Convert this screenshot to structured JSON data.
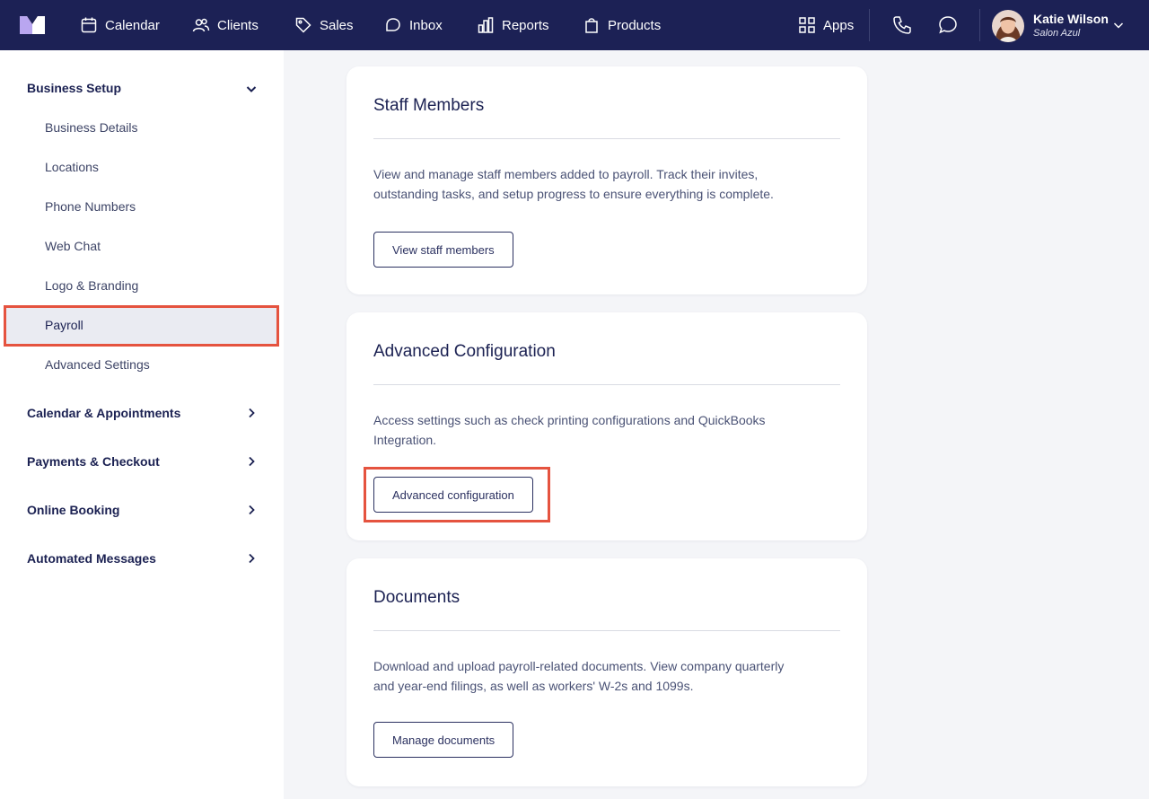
{
  "nav": {
    "items": [
      {
        "label": "Calendar",
        "icon": "calendar-icon"
      },
      {
        "label": "Clients",
        "icon": "clients-icon"
      },
      {
        "label": "Sales",
        "icon": "tag-icon"
      },
      {
        "label": "Inbox",
        "icon": "inbox-icon"
      },
      {
        "label": "Reports",
        "icon": "bar-chart-icon"
      },
      {
        "label": "Products",
        "icon": "bag-icon"
      }
    ],
    "apps_label": "Apps",
    "user": {
      "name": "Katie Wilson",
      "business": "Salon Azul"
    }
  },
  "sidebar": {
    "sections": [
      {
        "label": "Business Setup",
        "expanded": true
      },
      {
        "label": "Calendar & Appointments"
      },
      {
        "label": "Payments & Checkout"
      },
      {
        "label": "Online Booking"
      },
      {
        "label": "Automated Messages"
      }
    ],
    "business_setup_items": [
      {
        "label": "Business Details"
      },
      {
        "label": "Locations"
      },
      {
        "label": "Phone Numbers"
      },
      {
        "label": "Web Chat"
      },
      {
        "label": "Logo & Branding"
      },
      {
        "label": "Payroll",
        "active": true
      },
      {
        "label": "Advanced Settings"
      }
    ]
  },
  "cards": [
    {
      "title": "Staff Members",
      "description": "View and manage staff members added to payroll. Track their invites, outstanding tasks, and setup progress to ensure everything is complete.",
      "button": "View staff members"
    },
    {
      "title": "Advanced Configuration",
      "description": "Access settings such as check printing configurations and QuickBooks Integration.",
      "button": "Advanced configuration"
    },
    {
      "title": "Documents",
      "description": "Download and upload payroll-related documents. View company quarterly and year-end filings, as well as workers' W-2s and 1099s.",
      "button": "Manage documents"
    }
  ],
  "colors": {
    "nav_bg": "#1c2155",
    "highlight": "#e5533f",
    "active_item_bg": "#eaebf2",
    "page_bg": "#f4f5f8"
  }
}
